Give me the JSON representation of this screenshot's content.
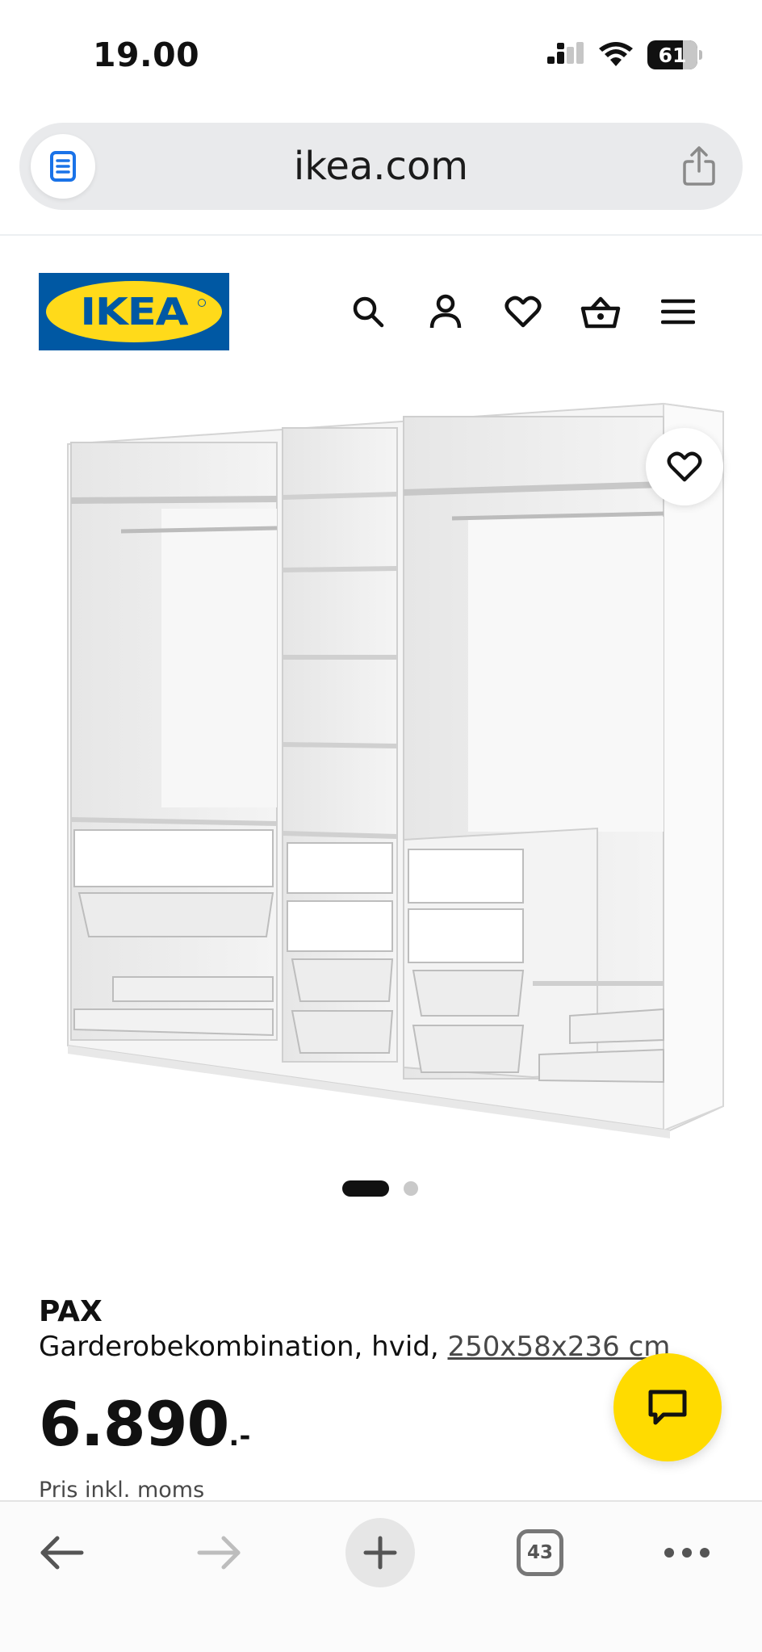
{
  "status_bar": {
    "time": "19.00",
    "battery": "61"
  },
  "browser": {
    "url": "ikea.com",
    "tab_count": "43"
  },
  "header": {
    "logo_text": "IKEA",
    "icons": [
      "search-icon",
      "account-icon",
      "favorites-icon",
      "cart-icon",
      "menu-icon"
    ]
  },
  "carousel": {
    "total_images": 2,
    "active_index": 0
  },
  "product": {
    "name": "PAX",
    "description": "Garderobekombination, hvid, ",
    "dimensions": "250x58x236 cm",
    "price": "6.890",
    "price_suffix": ".-",
    "price_note": "Pris inkl. moms"
  },
  "colors": {
    "ikea_blue": "#0058a3",
    "ikea_yellow": "#ffda1a",
    "chat_yellow": "#ffdb00"
  }
}
